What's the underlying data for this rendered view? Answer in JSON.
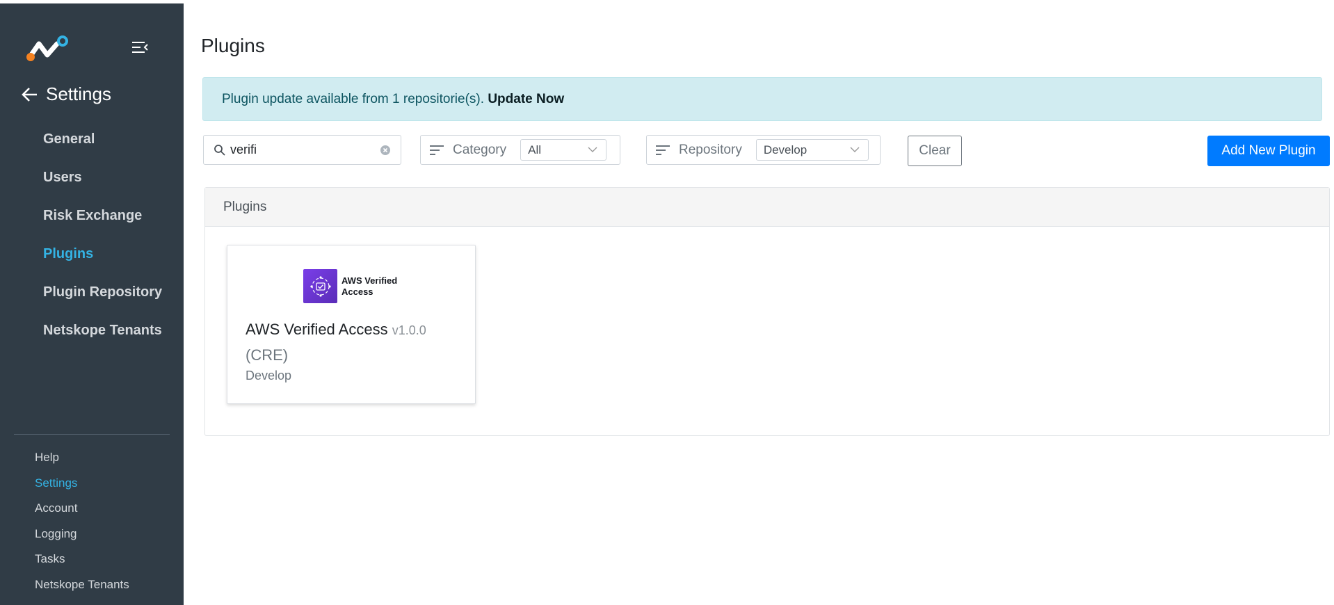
{
  "sidebar": {
    "header": {
      "title": "Settings"
    },
    "items": [
      {
        "label": "General",
        "active": false
      },
      {
        "label": "Users",
        "active": false
      },
      {
        "label": "Risk Exchange",
        "active": false
      },
      {
        "label": "Plugins",
        "active": true
      },
      {
        "label": "Plugin Repository",
        "active": false
      },
      {
        "label": "Netskope Tenants",
        "active": false
      }
    ],
    "bottom_items": [
      {
        "label": "Help",
        "active": false
      },
      {
        "label": "Settings",
        "active": true
      },
      {
        "label": "Account",
        "active": false
      },
      {
        "label": "Logging",
        "active": false
      },
      {
        "label": "Tasks",
        "active": false
      },
      {
        "label": "Netskope Tenants",
        "active": false
      }
    ]
  },
  "main": {
    "title": "Plugins",
    "alert": {
      "message": "Plugin update available from 1 repositorie(s). ",
      "action": "Update Now"
    },
    "search": {
      "value": "verifi",
      "placeholder": ""
    },
    "filters": {
      "category": {
        "label": "Category",
        "value": "All"
      },
      "repository": {
        "label": "Repository",
        "value": "Develop"
      }
    },
    "buttons": {
      "clear": "Clear",
      "add": "Add New Plugin"
    },
    "panel": {
      "title": "Plugins",
      "cards": [
        {
          "logo_text_line1": "AWS Verified",
          "logo_text_line2": "Access",
          "name": "AWS Verified Access",
          "version": "v1.0.0",
          "type": "(CRE)",
          "repository": "Develop"
        }
      ]
    }
  },
  "colors": {
    "sidebar_bg": "#303c46",
    "accent": "#34b3e4",
    "primary": "#007bff",
    "alert_bg": "#d1ecf1",
    "aws_purple": "#6b35d6"
  },
  "icons": [
    "netskope-logo",
    "collapse-menu-icon",
    "back-arrow-icon",
    "search-icon",
    "clear-search-icon",
    "filter-icon",
    "chevron-down-icon",
    "aws-verified-access-icon"
  ]
}
